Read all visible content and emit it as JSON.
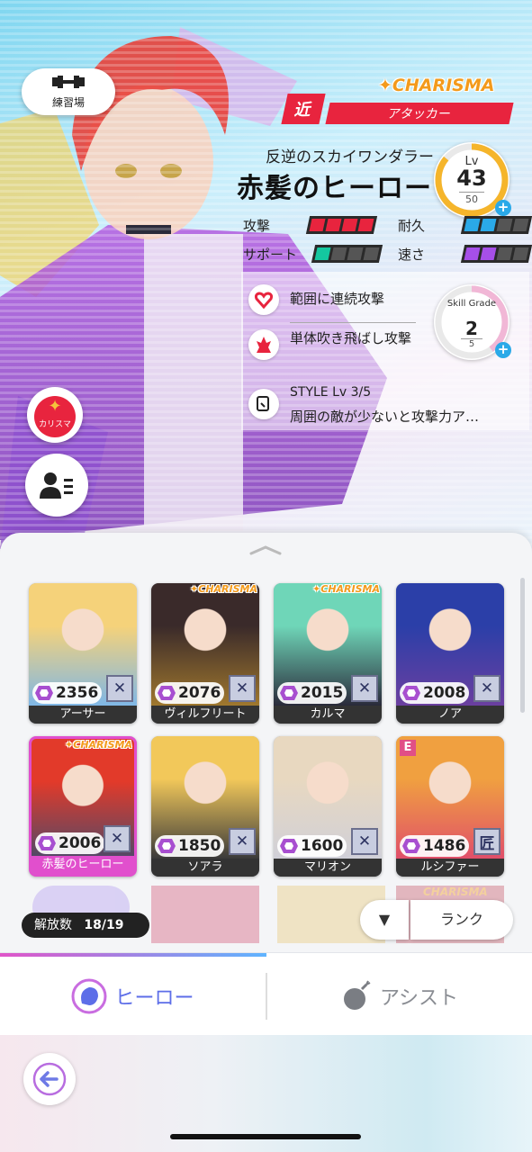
{
  "hero_panel": {
    "training_label": "練習場",
    "charisma_badge": "CHARISMA",
    "range": "近",
    "role": "アタッカー",
    "epithet": "反逆のスカイワンダラー",
    "name": "赤髪のヒーロー",
    "level": {
      "label": "Lv",
      "value": "43",
      "max": "50",
      "progress": 0.86
    },
    "stats": [
      {
        "label": "攻撃",
        "filled": 4,
        "total": 4,
        "color": "#e8243e"
      },
      {
        "label": "耐久",
        "filled": 2,
        "total": 4,
        "color": "#2aa9e8"
      },
      {
        "label": "サポート",
        "filled": 1,
        "total": 4,
        "color": "#14c8a0"
      },
      {
        "label": "速さ",
        "filled": 2,
        "total": 4,
        "color": "#a64fe8"
      }
    ],
    "skills": [
      {
        "icon": "heart-chain-icon",
        "text": "範囲に連続攻撃"
      },
      {
        "icon": "flame-burst-icon",
        "text": "単体吹き飛ばし攻撃"
      }
    ],
    "skill_grade": {
      "label": "Skill Grade",
      "value": "2",
      "max": "5",
      "progress": 0.4
    },
    "style": {
      "title": "STYLE Lv 3/5",
      "desc": "周囲の敵が少ないと攻撃力ア…"
    },
    "side_charisma_label": "カリスマ"
  },
  "heroes": [
    {
      "name": "アーサー",
      "power": "2356",
      "charisma": false,
      "e": false,
      "cls": "✕",
      "colors": [
        "#f5d27a",
        "#7fb7e6"
      ]
    },
    {
      "name": "ヴィルフリート",
      "power": "2076",
      "charisma": true,
      "e": false,
      "cls": "✕",
      "colors": [
        "#3a2a2a",
        "#a0782e"
      ]
    },
    {
      "name": "カルマ",
      "power": "2015",
      "charisma": true,
      "e": false,
      "cls": "✕",
      "colors": [
        "#6fd6b8",
        "#2a2a3a"
      ]
    },
    {
      "name": "ノア",
      "power": "2008",
      "charisma": false,
      "e": false,
      "cls": "✕",
      "colors": [
        "#2b3fa8",
        "#6b3fa0"
      ]
    },
    {
      "name": "赤髪のヒーロー",
      "power": "2006",
      "charisma": true,
      "e": false,
      "cls": "✕",
      "colors": [
        "#e23a2a",
        "#4a4a6a"
      ]
    },
    {
      "name": "ソアラ",
      "power": "1850",
      "charisma": false,
      "e": false,
      "cls": "✕",
      "colors": [
        "#f2c85a",
        "#3a3a3a"
      ]
    },
    {
      "name": "マリオン",
      "power": "1600",
      "charisma": false,
      "e": false,
      "cls": "✕",
      "colors": [
        "#e8d8c0",
        "#d0d0d8"
      ]
    },
    {
      "name": "ルシファー",
      "power": "1486",
      "charisma": false,
      "e": true,
      "cls": "匠",
      "colors": [
        "#f0a040",
        "#e04f6a"
      ]
    }
  ],
  "faded_row_charisma": "CHARISMA",
  "unlock": {
    "label": "解放数",
    "value": "18/19"
  },
  "sort": {
    "toggle": "▼",
    "label": "ランク"
  },
  "tabs": {
    "hero": "ヒーロー",
    "assist": "アシスト"
  },
  "colors": {
    "accent_red": "#e8243e",
    "accent_blue": "#5d6ee8",
    "selection": "#e14fcd",
    "charisma": "#f39a1b"
  }
}
